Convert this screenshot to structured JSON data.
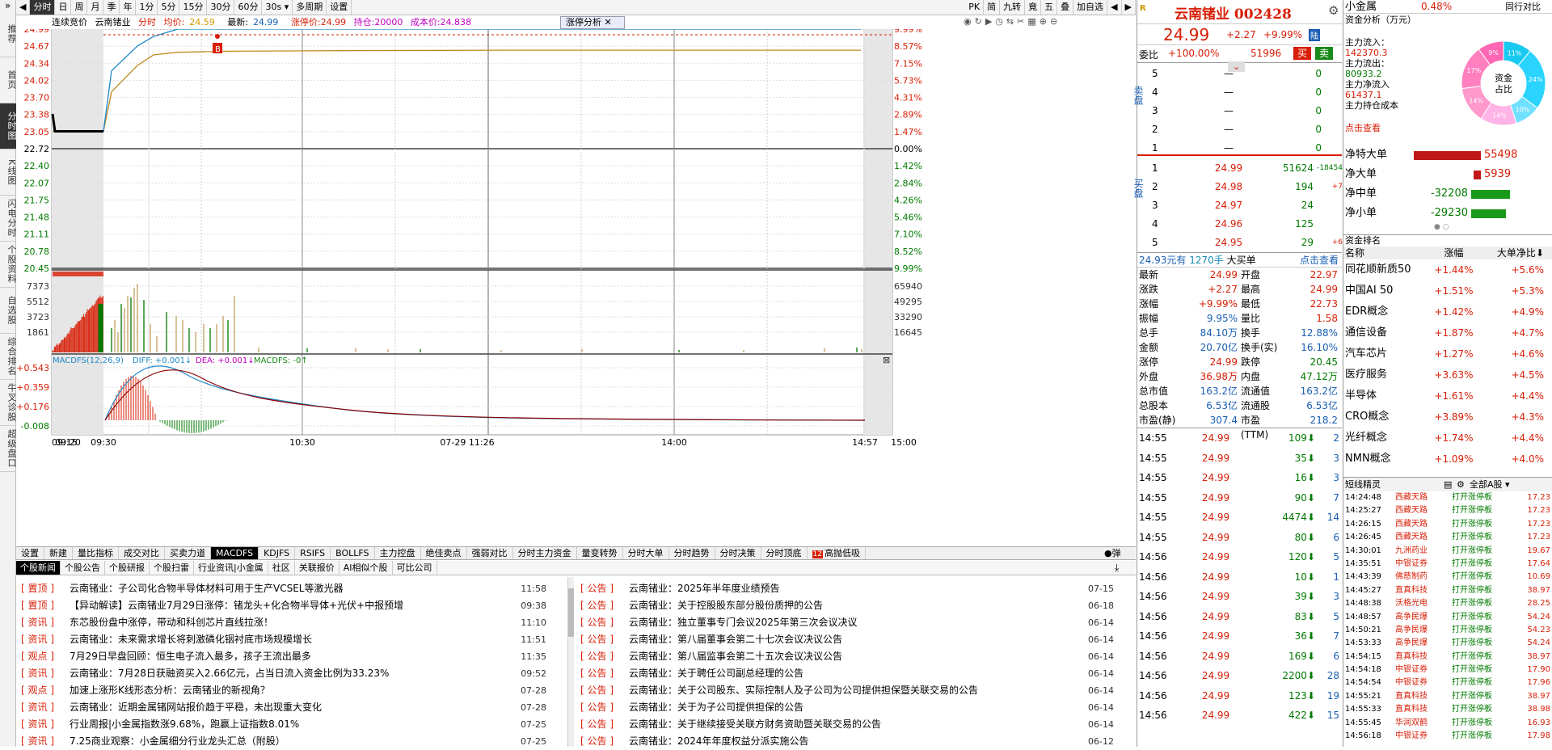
{
  "left_nav": [
    "推荐",
    "首页",
    "分时图",
    "K线图",
    "闪电分时",
    "个股资料",
    "自选股",
    "综合排名",
    "牛叉诊股",
    "超级盘口"
  ],
  "toolbar": {
    "items": [
      "分时",
      "日",
      "周",
      "月",
      "季",
      "年",
      "1分",
      "5分",
      "15分",
      "30分",
      "60分",
      "30s",
      "多周期",
      "设置"
    ],
    "active": "分时",
    "right": [
      "PK",
      "简",
      "九转",
      "竟",
      "五",
      "叠",
      "加自选"
    ]
  },
  "info": {
    "title": "连续竞价",
    "name": "云南锗业",
    "ftype": "分时",
    "avg_label": "均价:",
    "avg": "24.59",
    "last_label": "最新:",
    "last": "24.99",
    "limit_label": "涨停价:24.99",
    "hold_label": "持仓:20000",
    "cost_label": "成本价:24.838",
    "analysis_btn": "涨停分析"
  },
  "axes": {
    "price_left": [
      "24.99",
      "24.67",
      "24.34",
      "24.02",
      "23.70",
      "23.38",
      "23.05",
      "22.72",
      "22.40",
      "22.07",
      "21.75",
      "21.48",
      "21.11",
      "20.78",
      "20.45"
    ],
    "pct_right": [
      "9.99%",
      "8.57%",
      "7.15%",
      "5.73%",
      "4.31%",
      "2.89%",
      "1.47%",
      "0.00%",
      "1.42%",
      "2.84%",
      "4.26%",
      "5.46%",
      "7.10%",
      "8.52%",
      "9.99%"
    ],
    "vol_left": [
      "7373",
      "5512",
      "3723",
      "1861"
    ],
    "vol_right": [
      "65940",
      "49295",
      "33290",
      "16645"
    ],
    "macd_left": [
      "+0.543",
      "+0.359",
      "+0.176",
      "-0.008"
    ],
    "time": [
      "09:15",
      "09:20",
      "09:30",
      "10:30",
      "07-29 11:26",
      "14:00",
      "14:57",
      "15:00"
    ]
  },
  "macd_label": "MACDFS(12,26,9)",
  "macd_diff": "DIFF: +0.001↓",
  "macd_dea": "DEA: +0.001↓",
  "macd_val": "MACDFS: -0↑",
  "buy_marker": "B",
  "chart_data": {
    "type": "line",
    "title": "云南锗业 分时",
    "series": [
      {
        "name": "价格",
        "values": [
          23.38,
          23.05,
          23.05,
          23.05,
          23.05,
          24.2,
          24.67,
          24.85,
          24.99,
          24.99,
          24.99,
          24.99,
          24.99,
          24.99,
          24.99
        ]
      },
      {
        "name": "均价",
        "values": [
          23.05,
          23.05,
          23.05,
          23.05,
          23.05,
          23.8,
          24.3,
          24.5,
          24.55,
          24.57,
          24.58,
          24.59,
          24.59,
          24.59,
          24.59
        ]
      }
    ],
    "ylim": [
      20.45,
      24.99
    ]
  },
  "bottom_tabs": [
    "设置",
    "新建",
    "量比指标",
    "成交对比",
    "买卖力道",
    "MACDFS",
    "KDJFS",
    "RSIFS",
    "BOLLFS",
    "主力控盘",
    "绝佳卖点",
    "强弱对比",
    "分时主力资金",
    "量变转势",
    "分时大单",
    "分时趋势",
    "分时决策",
    "分时顶底",
    "高抛低吸"
  ],
  "bottom_active": "MACDFS",
  "bubble": "弹",
  "news_tabs": [
    "个股新闻",
    "个股公告",
    "个股研报",
    "个股扫雷",
    "行业资讯|小金属",
    "社区",
    "关联报价",
    "AI相似个股",
    "可比公司"
  ],
  "news_left": [
    {
      "tag": "置顶",
      "text": "云南锗业：子公司化合物半导体材料可用于生产VCSEL等激光器",
      "time": "11:58"
    },
    {
      "tag": "置顶",
      "text": "【异动解读】云南锗业7月29日涨停：锗龙头+化合物半导体+光伏+中报预增",
      "time": "09:38"
    },
    {
      "tag": "资讯",
      "text": "东芯股份盘中涨停，带动和科创芯片直线拉涨！",
      "time": "11:10"
    },
    {
      "tag": "资讯",
      "text": "云南锗业：未来需求增长将刺激磷化铟衬底市场规模增长",
      "time": "11:51"
    },
    {
      "tag": "观点",
      "text": "7月29日早盘回顾：恒生电子流入最多，孩子王流出最多",
      "time": "11:35"
    },
    {
      "tag": "资讯",
      "text": "云南锗业：7月28日获融资买入2.66亿元，占当日流入资金比例为33.23%",
      "time": "09:52"
    },
    {
      "tag": "观点",
      "text": "加速上涨形K线形态分析：云南锗业的新视角？",
      "time": "07-28"
    },
    {
      "tag": "资讯",
      "text": "云南锗业：近期金属锗网站报价趋于平稳，未出现重大变化",
      "time": "07-28"
    },
    {
      "tag": "资讯",
      "text": "行业周报|小金属指数涨9.68%，跑赢上证指数8.01%",
      "time": "07-25"
    },
    {
      "tag": "资讯",
      "text": "7.25商业观察：小金属细分行业龙头汇总（附股）",
      "time": "07-25"
    }
  ],
  "news_right": [
    {
      "tag": "公告",
      "text": "云南锗业：2025年半年度业绩预告",
      "time": "07-15"
    },
    {
      "tag": "公告",
      "text": "云南锗业：关于控股股东部分股份质押的公告",
      "time": "06-18"
    },
    {
      "tag": "公告",
      "text": "云南锗业：独立董事专门会议2025年第三次会议决议",
      "time": "06-14"
    },
    {
      "tag": "公告",
      "text": "云南锗业：第八届董事会第二十七次会议决议公告",
      "time": "06-14"
    },
    {
      "tag": "公告",
      "text": "云南锗业：第八届监事会第二十五次会议决议公告",
      "time": "06-14"
    },
    {
      "tag": "公告",
      "text": "云南锗业：关于聘任公司副总经理的公告",
      "time": "06-14"
    },
    {
      "tag": "公告",
      "text": "云南锗业：关于公司股东、实际控制人及子公司为公司提供担保暨关联交易的公告",
      "time": "06-14"
    },
    {
      "tag": "公告",
      "text": "云南锗业：关于为子公司提供担保的公告",
      "time": "06-14"
    },
    {
      "tag": "公告",
      "text": "云南锗业：关于继续接受关联方财务资助暨关联交易的公告",
      "time": "06-14"
    },
    {
      "tag": "公告",
      "text": "云南锗业：2024年年度权益分派实施公告",
      "time": "06-12"
    }
  ],
  "quote": {
    "r_mark": "R",
    "name": "云南锗业 002428",
    "price": "24.99",
    "chg": "+2.27",
    "pct": "+9.99%",
    "lu": "陆",
    "wb_label": "委比",
    "wb": "+100.00%",
    "wb_vol": "51996",
    "buy_btn": "买",
    "sell_btn": "卖",
    "sell_label": "卖盘",
    "buy_label": "买盘",
    "asks": [
      {
        "lv": "5",
        "p": "—",
        "v": "0"
      },
      {
        "lv": "4",
        "p": "—",
        "v": "0"
      },
      {
        "lv": "3",
        "p": "—",
        "v": "0"
      },
      {
        "lv": "2",
        "p": "—",
        "v": "0"
      },
      {
        "lv": "1",
        "p": "—",
        "v": "0"
      }
    ],
    "bids": [
      {
        "lv": "1",
        "p": "24.99",
        "v": "51624",
        "d": "-18454"
      },
      {
        "lv": "2",
        "p": "24.98",
        "v": "194",
        "d": "+7"
      },
      {
        "lv": "3",
        "p": "24.97",
        "v": "24",
        "d": ""
      },
      {
        "lv": "4",
        "p": "24.96",
        "v": "125",
        "d": ""
      },
      {
        "lv": "5",
        "p": "24.95",
        "v": "29",
        "d": "+6"
      }
    ],
    "big_line": {
      "a": "24.93元有",
      "b": "1270手",
      "c": "大买单",
      "d": "点击查看"
    },
    "stats": [
      [
        "最新",
        "24.99",
        "开盘",
        "22.97"
      ],
      [
        "涨跌",
        "+2.27",
        "最高",
        "24.99"
      ],
      [
        "涨幅",
        "+9.99%",
        "最低",
        "22.73"
      ],
      [
        "振幅",
        "9.95%",
        "量比",
        "1.58"
      ],
      [
        "总手",
        "84.10万",
        "换手",
        "12.88%"
      ],
      [
        "金额",
        "20.70亿",
        "换手(实)",
        "16.10%"
      ],
      [
        "涨停",
        "24.99",
        "跌停",
        "20.45"
      ],
      [
        "外盘",
        "36.98万",
        "内盘",
        "47.12万"
      ],
      [
        "总市值",
        "163.2亿",
        "流通值",
        "163.2亿"
      ],
      [
        "总股本",
        "6.53亿",
        "流通股",
        "6.53亿"
      ],
      [
        "市盈(静)",
        "307.4",
        "市盈(TTM)",
        "218.2"
      ]
    ],
    "ticks": [
      [
        "14:55",
        "24.99",
        "109",
        "2"
      ],
      [
        "14:55",
        "24.99",
        "35",
        "3"
      ],
      [
        "14:55",
        "24.99",
        "16",
        "3"
      ],
      [
        "14:55",
        "24.99",
        "90",
        "7"
      ],
      [
        "14:55",
        "24.99",
        "4474",
        "14"
      ],
      [
        "14:55",
        "24.99",
        "80",
        "6"
      ],
      [
        "14:56",
        "24.99",
        "120",
        "5"
      ],
      [
        "14:56",
        "24.99",
        "10",
        "1"
      ],
      [
        "14:56",
        "24.99",
        "39",
        "3"
      ],
      [
        "14:56",
        "24.99",
        "83",
        "5"
      ],
      [
        "14:56",
        "24.99",
        "36",
        "7"
      ],
      [
        "14:56",
        "24.99",
        "169",
        "6"
      ],
      [
        "14:56",
        "24.99",
        "2200",
        "28"
      ],
      [
        "14:56",
        "24.99",
        "123",
        "19"
      ],
      [
        "14:56",
        "24.99",
        "422",
        "15"
      ]
    ]
  },
  "fund": {
    "sector": "小金属",
    "sector_pct": "0.48%",
    "peer": "同行对比",
    "title": "资金分析（万元）",
    "flows": [
      [
        "主力流入：",
        "142370.3"
      ],
      [
        "主力流出：",
        "80933.2"
      ],
      [
        "主力净流入",
        "61437.1"
      ],
      [
        "主力持仓成本",
        ""
      ]
    ],
    "click": "点击查看",
    "donut_center1": "资金",
    "donut_center2": "占比",
    "donut_vals": [
      "11%",
      "24%",
      "10%",
      "14%",
      "14%",
      "17%",
      "9%"
    ],
    "net": [
      [
        "净特大单",
        "55498",
        0.9,
        "red"
      ],
      [
        "净大单",
        "5939",
        0.1,
        "red"
      ],
      [
        "净中单",
        "-32208",
        0.52,
        "green"
      ],
      [
        "净小单",
        "-29230",
        0.47,
        "green"
      ]
    ],
    "rank_title": "资金排名",
    "rank_cols": [
      "名称",
      "涨幅",
      "大单净比"
    ],
    "rank": [
      [
        "同花顺新质50",
        "+1.44%",
        "+5.6%"
      ],
      [
        "中国AI 50",
        "+1.51%",
        "+5.3%"
      ],
      [
        "EDR概念",
        "+1.42%",
        "+4.9%"
      ],
      [
        "通信设备",
        "+1.87%",
        "+4.7%"
      ],
      [
        "汽车芯片",
        "+1.27%",
        "+4.6%"
      ],
      [
        "医疗服务",
        "+3.63%",
        "+4.5%"
      ],
      [
        "半导体",
        "+1.61%",
        "+4.4%"
      ],
      [
        "CRO概念",
        "+3.89%",
        "+4.3%"
      ],
      [
        "光纤概念",
        "+1.74%",
        "+4.4%"
      ],
      [
        "NMN概念",
        "+1.09%",
        "+4.0%"
      ]
    ],
    "jl_title": "短线精灵",
    "jl_filter": "全部A股",
    "jl": [
      [
        "14:24:48",
        "西藏天路",
        "打开涨停板",
        "17.23"
      ],
      [
        "14:25:27",
        "西藏天路",
        "打开涨停板",
        "17.23"
      ],
      [
        "14:26:15",
        "西藏天路",
        "打开涨停板",
        "17.23"
      ],
      [
        "14:26:45",
        "西藏天路",
        "打开涨停板",
        "17.23"
      ],
      [
        "14:30:01",
        "九洲药业",
        "打开涨停板",
        "19.67"
      ],
      [
        "14:35:51",
        "中银证券",
        "打开涨停板",
        "17.64"
      ],
      [
        "14:43:39",
        "佛慈制药",
        "打开涨停板",
        "10.69"
      ],
      [
        "14:45:27",
        "直真科技",
        "打开涨停板",
        "38.97"
      ],
      [
        "14:48:38",
        "沃格光电",
        "打开涨停板",
        "28.25"
      ],
      [
        "14:48:57",
        "高争民爆",
        "打开涨停板",
        "54.24"
      ],
      [
        "14:50:21",
        "高争民爆",
        "打开涨停板",
        "54.23"
      ],
      [
        "14:53:33",
        "高争民爆",
        "打开涨停板",
        "54.24"
      ],
      [
        "14:54:15",
        "直真科技",
        "打开涨停板",
        "38.97"
      ],
      [
        "14:54:18",
        "中银证券",
        "打开涨停板",
        "17.90"
      ],
      [
        "14:54:54",
        "中银证券",
        "打开涨停板",
        "17.96"
      ],
      [
        "14:55:21",
        "直真科技",
        "打开涨停板",
        "38.97"
      ],
      [
        "14:55:33",
        "直真科技",
        "打开涨停板",
        "38.98"
      ],
      [
        "14:55:45",
        "华润双鹤",
        "打开涨停板",
        "16.93"
      ],
      [
        "14:56:18",
        "中银证券",
        "打开涨停板",
        "17.98"
      ]
    ]
  }
}
